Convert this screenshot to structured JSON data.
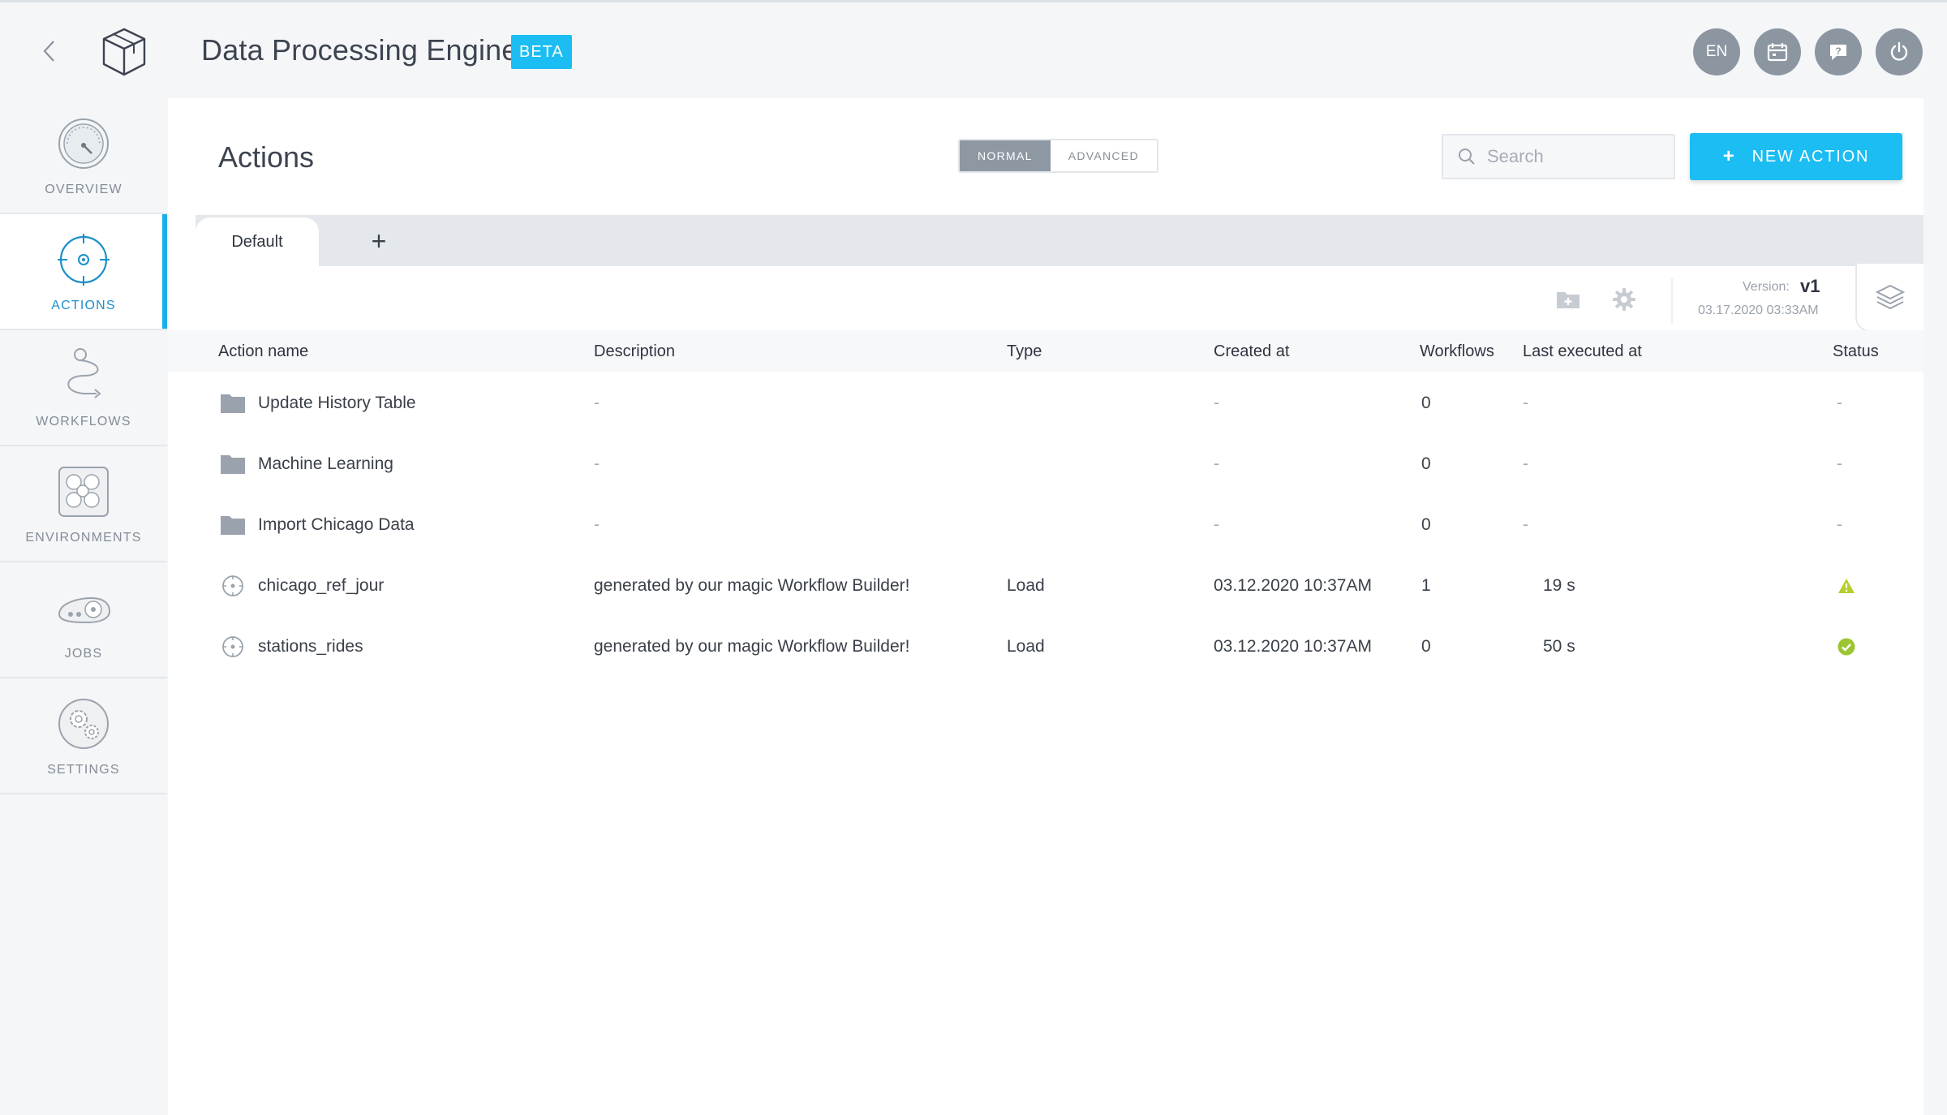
{
  "header": {
    "title": "Data Processing Engine",
    "badge": "BETA",
    "lang": "EN"
  },
  "sidebar": {
    "items": [
      {
        "label": "OVERVIEW",
        "icon": "gauge-icon"
      },
      {
        "label": "ACTIONS",
        "icon": "target-icon",
        "active": true
      },
      {
        "label": "WORKFLOWS",
        "icon": "workflow-icon"
      },
      {
        "label": "ENVIRONMENTS",
        "icon": "environments-icon"
      },
      {
        "label": "JOBS",
        "icon": "jobs-icon"
      },
      {
        "label": "SETTINGS",
        "icon": "gears-icon"
      }
    ]
  },
  "main": {
    "title": "Actions",
    "mode_toggle": {
      "normal": "NORMAL",
      "advanced": "ADVANCED",
      "selected": "NORMAL"
    },
    "search": {
      "placeholder": "Search"
    },
    "new_action": "NEW ACTION",
    "tabs": [
      {
        "label": "Default"
      }
    ],
    "version": {
      "label": "Version:",
      "value": "v1",
      "date": "03.17.2020 03:33AM"
    }
  },
  "table": {
    "columns": [
      "Action name",
      "Description",
      "Type",
      "Created at",
      "Workflows",
      "Last executed at",
      "Status"
    ],
    "rows": [
      {
        "kind": "folder",
        "name": "Update History Table",
        "description": "-",
        "type": "",
        "created": "-",
        "workflows": "0",
        "last": "-",
        "status": "-"
      },
      {
        "kind": "folder",
        "name": "Machine Learning",
        "description": "-",
        "type": "",
        "created": "-",
        "workflows": "0",
        "last": "-",
        "status": "-"
      },
      {
        "kind": "folder",
        "name": "Import Chicago Data",
        "description": "-",
        "type": "",
        "created": "-",
        "workflows": "0",
        "last": "-",
        "status": "-"
      },
      {
        "kind": "action",
        "name": "chicago_ref_jour",
        "description": "generated by our magic Workflow Builder!",
        "type": "Load",
        "created": "03.12.2020 10:37AM",
        "workflows": "1",
        "last": "19 s",
        "status": "warning"
      },
      {
        "kind": "action",
        "name": "stations_rides",
        "description": "generated by our magic Workflow Builder!",
        "type": "Load",
        "created": "03.12.2020 10:37AM",
        "workflows": "0",
        "last": "50 s",
        "status": "success"
      }
    ]
  },
  "colors": {
    "accent": "#1bbdf2",
    "active_nav": "#1a8fc9",
    "warning": "#b8cc2a",
    "success": "#9cc631"
  }
}
